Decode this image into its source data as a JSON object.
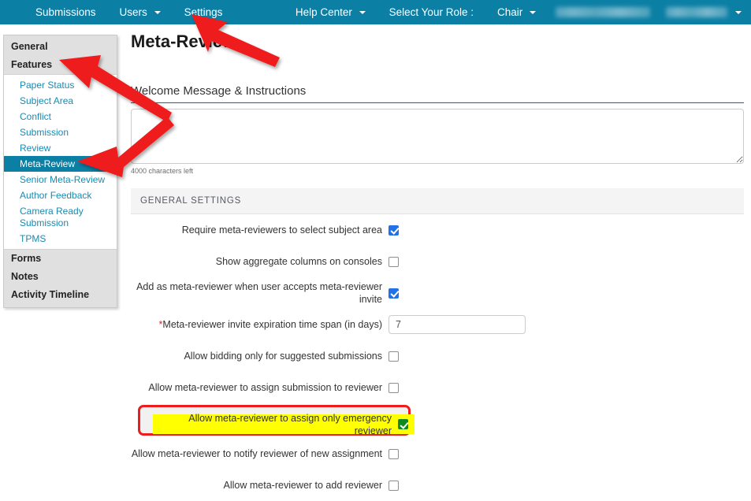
{
  "topnav": {
    "background": "#0c7fa5",
    "left_items": [
      {
        "label": "Submissions",
        "has_caret": false
      },
      {
        "label": "Users",
        "has_caret": true
      },
      {
        "label": "Settings",
        "has_caret": false
      }
    ],
    "right_items": [
      {
        "label": "Help Center",
        "has_caret": true
      },
      {
        "label": "Select Your Role :",
        "has_caret": false
      },
      {
        "label": "Chair",
        "has_caret": true
      }
    ],
    "redacted_1": "",
    "redacted_2": ""
  },
  "sidebar": {
    "groups": [
      {
        "label": "General",
        "type": "group"
      },
      {
        "label": "Features",
        "type": "group"
      }
    ],
    "feature_items": [
      {
        "label": "Paper Status",
        "active": false
      },
      {
        "label": "Subject Area",
        "active": false
      },
      {
        "label": "Conflict",
        "active": false
      },
      {
        "label": "Submission",
        "active": false
      },
      {
        "label": "Review",
        "active": false
      },
      {
        "label": "Meta-Review",
        "active": true
      },
      {
        "label": "Senior Meta-Review",
        "active": false
      },
      {
        "label": "Author Feedback",
        "active": false
      },
      {
        "label": "Camera Ready",
        "active": false
      },
      {
        "label": "Submission",
        "active": false
      },
      {
        "label": "TPMS",
        "active": false
      }
    ],
    "bottom_groups": [
      {
        "label": "Forms"
      },
      {
        "label": "Notes"
      },
      {
        "label": "Activity Timeline"
      }
    ],
    "active_color": "#0c7fa5",
    "link_color": "#1a8ab0"
  },
  "main": {
    "page_title": "Meta-Review",
    "welcome_label": "Welcome Message & Instructions",
    "welcome_value": "",
    "welcome_placeholder": "",
    "chars_left": "4000 characters left"
  },
  "settings": {
    "panel_header": "GENERAL SETTINGS",
    "rows": [
      {
        "label": "Require meta-reviewers to select subject area",
        "control": "checkbox",
        "checked": true,
        "required": false,
        "highlighted": false
      },
      {
        "label": "Show aggregate columns on consoles",
        "control": "checkbox",
        "checked": false,
        "required": false,
        "highlighted": false
      },
      {
        "label": "Add as meta-reviewer when user accepts meta-reviewer invite",
        "control": "checkbox",
        "checked": true,
        "required": false,
        "highlighted": false
      },
      {
        "label": "Meta-reviewer invite expiration time span (in days)",
        "control": "text",
        "value": "7",
        "required": true,
        "highlighted": false
      },
      {
        "label": "Allow bidding only for suggested submissions",
        "control": "checkbox",
        "checked": false,
        "required": false,
        "highlighted": false
      },
      {
        "label": "Allow meta-reviewer to assign submission to reviewer",
        "control": "checkbox",
        "checked": false,
        "required": false,
        "highlighted": false
      },
      {
        "label": "Allow meta-reviewer to assign only emergency reviewer",
        "control": "checkbox",
        "checked": true,
        "required": false,
        "highlighted": true
      },
      {
        "label": "Allow meta-reviewer to notify reviewer of new assignment",
        "control": "checkbox",
        "checked": false,
        "required": false,
        "highlighted": false
      },
      {
        "label": "Allow meta-reviewer to add reviewer",
        "control": "checkbox",
        "checked": false,
        "required": false,
        "highlighted": false
      }
    ],
    "highlight_border_color": "#ee1c1c",
    "highlight_fill_color": "#ffff00",
    "checked_color": "#1f72e8",
    "required_marker": "*"
  },
  "annotations": {
    "arrow_color": "#ee1c1c",
    "arrows": [
      {
        "name": "arrow-to-settings",
        "points_to": "Settings"
      },
      {
        "name": "arrow-to-features",
        "points_to": "Features"
      },
      {
        "name": "arrow-to-meta-review",
        "points_to": "Meta-Review"
      }
    ]
  }
}
